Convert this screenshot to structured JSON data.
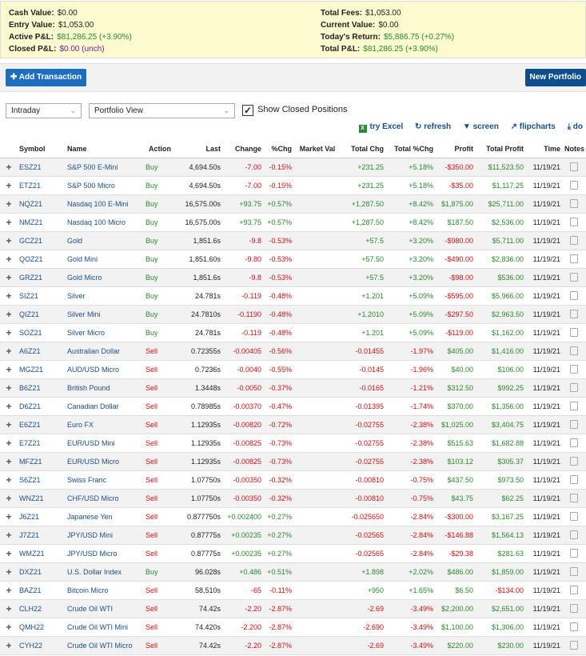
{
  "summary": {
    "left": [
      {
        "label": "Cash Value:",
        "value": "$0.00",
        "color": "default"
      },
      {
        "label": "Entry Value:",
        "value": "$1,053.00",
        "color": "default"
      },
      {
        "label": "Active P&L:",
        "value": "$81,286.25 (+3.90%)",
        "color": "g"
      },
      {
        "label": "Closed P&L:",
        "value": "$0.00 (unch)",
        "color": "p"
      }
    ],
    "right": [
      {
        "label": "Total Fees:",
        "value": "$1,053.00",
        "color": "default"
      },
      {
        "label": "Current Value:",
        "value": "$0.00",
        "color": "default"
      },
      {
        "label": "Today's Return:",
        "value": "$5,886.75 (+0.27%)",
        "color": "g"
      },
      {
        "label": "Total P&L:",
        "value": "$81,286.25 (+3.90%)",
        "color": "g"
      }
    ]
  },
  "toolbar": {
    "add_transaction": "Add Transaction",
    "new_portfolio": "New Portfolio"
  },
  "controls": {
    "period": "Intraday",
    "view": "Portfolio View",
    "show_closed_label": "Show Closed Positions",
    "show_closed_checked": true
  },
  "links": {
    "excel": "try Excel",
    "refresh": "refresh",
    "screen": "screen",
    "flipcharts": "flipcharts",
    "download": "do"
  },
  "columns": [
    "Symbol",
    "Name",
    "Action",
    "Last",
    "Change",
    "%Chg",
    "Market Val",
    "Total Chg",
    "Total %Chg",
    "Profit",
    "Total Profit",
    "Time",
    "Notes"
  ],
  "rows": [
    [
      "ESZ21",
      "S&P 500 E-Mini",
      "Buy",
      "4,694.50s",
      "-7.00",
      "-0.15%",
      "",
      "+231.25",
      "+5.18%",
      "-$350.00",
      "$11,523.50",
      "11/19/21"
    ],
    [
      "ETZ21",
      "S&P 500 Micro",
      "Buy",
      "4,694.50s",
      "-7.00",
      "-0.15%",
      "",
      "+231.25",
      "+5.18%",
      "-$35.00",
      "$1,117.25",
      "11/19/21"
    ],
    [
      "NQZ21",
      "Nasdaq 100 E-Mini",
      "Buy",
      "16,575.00s",
      "+93.75",
      "+0.57%",
      "",
      "+1,287.50",
      "+8.42%",
      "$1,875.00",
      "$25,711.00",
      "11/19/21"
    ],
    [
      "NMZ21",
      "Nasdaq 100 Micro",
      "Buy",
      "16,575.00s",
      "+93.75",
      "+0.57%",
      "",
      "+1,287.50",
      "+8.42%",
      "$187.50",
      "$2,536.00",
      "11/19/21"
    ],
    [
      "GCZ21",
      "Gold",
      "Buy",
      "1,851.6s",
      "-9.8",
      "-0.53%",
      "",
      "+57.5",
      "+3.20%",
      "-$980.00",
      "$5,711.00",
      "11/19/21"
    ],
    [
      "QOZ21",
      "Gold Mini",
      "Buy",
      "1,851.60s",
      "-9.80",
      "-0.53%",
      "",
      "+57.50",
      "+3.20%",
      "-$490.00",
      "$2,836.00",
      "11/19/21"
    ],
    [
      "GRZ21",
      "Gold Micro",
      "Buy",
      "1,851.6s",
      "-9.8",
      "-0.53%",
      "",
      "+57.5",
      "+3.20%",
      "-$98.00",
      "$536.00",
      "11/19/21"
    ],
    [
      "SIZ21",
      "Silver",
      "Buy",
      "24.781s",
      "-0.119",
      "-0.48%",
      "",
      "+1.201",
      "+5.09%",
      "-$595.00",
      "$5,966.00",
      "11/19/21"
    ],
    [
      "QIZ21",
      "Silver Mini",
      "Buy",
      "24.7810s",
      "-0.1190",
      "-0.48%",
      "",
      "+1.2010",
      "+5.09%",
      "-$297.50",
      "$2,963.50",
      "11/19/21"
    ],
    [
      "SOZ21",
      "Silver Micro",
      "Buy",
      "24.781s",
      "-0.119",
      "-0.48%",
      "",
      "+1.201",
      "+5.09%",
      "-$119.00",
      "$1,162.00",
      "11/19/21"
    ],
    [
      "A6Z21",
      "Australian Dollar",
      "Sell",
      "0.72355s",
      "-0.00405",
      "-0.56%",
      "",
      "-0.01455",
      "-1.97%",
      "$405.00",
      "$1,416.00",
      "11/19/21"
    ],
    [
      "MGZ21",
      "AUD/USD Micro",
      "Sell",
      "0.7236s",
      "-0.0040",
      "-0.55%",
      "",
      "-0.0145",
      "-1.96%",
      "$40.00",
      "$106.00",
      "11/19/21"
    ],
    [
      "B6Z21",
      "British Pound",
      "Sell",
      "1.3448s",
      "-0.0050",
      "-0.37%",
      "",
      "-0.0165",
      "-1.21%",
      "$312.50",
      "$992.25",
      "11/19/21"
    ],
    [
      "D6Z21",
      "Canadian Dollar",
      "Sell",
      "0.78985s",
      "-0.00370",
      "-0.47%",
      "",
      "-0.01395",
      "-1.74%",
      "$370.00",
      "$1,356.00",
      "11/19/21"
    ],
    [
      "E6Z21",
      "Euro FX",
      "Sell",
      "1.12935s",
      "-0.00820",
      "-0.72%",
      "",
      "-0.02755",
      "-2.38%",
      "$1,025.00",
      "$3,404.75",
      "11/19/21"
    ],
    [
      "E7Z21",
      "EUR/USD Mini",
      "Sell",
      "1.12935s",
      "-0.00825",
      "-0.73%",
      "",
      "-0.02755",
      "-2.38%",
      "$515.63",
      "$1,682.88",
      "11/19/21"
    ],
    [
      "MFZ21",
      "EUR/USD Micro",
      "Sell",
      "1.12935s",
      "-0.00825",
      "-0.73%",
      "",
      "-0.02755",
      "-2.38%",
      "$103.12",
      "$305.37",
      "11/19/21"
    ],
    [
      "S6Z21",
      "Swiss Franc",
      "Sell",
      "1.07750s",
      "-0.00350",
      "-0.32%",
      "",
      "-0.00810",
      "-0.75%",
      "$437.50",
      "$973.50",
      "11/19/21"
    ],
    [
      "WNZ21",
      "CHF/USD Micro",
      "Sell",
      "1.07750s",
      "-0.00350",
      "-0.32%",
      "",
      "-0.00810",
      "-0.75%",
      "$43.75",
      "$62.25",
      "11/19/21"
    ],
    [
      "J6Z21",
      "Japanese Yen",
      "Sell",
      "0.877750s",
      "+0.002400",
      "+0.27%",
      "",
      "-0.025650",
      "-2.84%",
      "-$300.00",
      "$3,167.25",
      "11/19/21"
    ],
    [
      "J7Z21",
      "JPY/USD Mini",
      "Sell",
      "0.87775s",
      "+0.00235",
      "+0.27%",
      "",
      "-0.02565",
      "-2.84%",
      "-$146.88",
      "$1,564.13",
      "11/19/21"
    ],
    [
      "WMZ21",
      "JPY/USD Micro",
      "Sell",
      "0.87775s",
      "+0.00235",
      "+0.27%",
      "",
      "-0.02565",
      "-2.84%",
      "-$29.38",
      "$281.63",
      "11/19/21"
    ],
    [
      "DXZ21",
      "U.S. Dollar Index",
      "Buy",
      "96.028s",
      "+0.486",
      "+0.51%",
      "",
      "+1.898",
      "+2.02%",
      "$486.00",
      "$1,859.00",
      "11/19/21"
    ],
    [
      "BAZ21",
      "Bitcoin Micro",
      "Sell",
      "58,510s",
      "-65",
      "-0.11%",
      "",
      "+950",
      "+1.65%",
      "$6.50",
      "-$134.00",
      "11/19/21"
    ],
    [
      "CLH22",
      "Crude Oil WTI",
      "Sell",
      "74.42s",
      "-2.20",
      "-2.87%",
      "",
      "-2.69",
      "-3.49%",
      "$2,200.00",
      "$2,651.00",
      "11/19/21"
    ],
    [
      "QMH22",
      "Crude Oil WTI Mini",
      "Sell",
      "74.420s",
      "-2.200",
      "-2.87%",
      "",
      "-2.690",
      "-3.49%",
      "$1,100.00",
      "$1,306.00",
      "11/19/21"
    ],
    [
      "CYH22",
      "Crude Oil WTI Micro",
      "Sell",
      "74.42s",
      "-2.20",
      "-2.87%",
      "",
      "-2.69",
      "-3.49%",
      "$220.00",
      "$230.00",
      "11/19/21"
    ]
  ]
}
